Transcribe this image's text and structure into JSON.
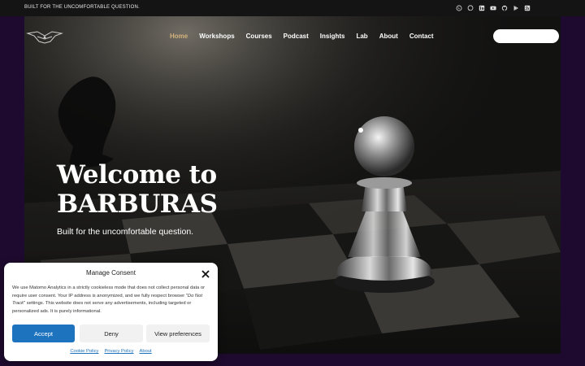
{
  "topbar": {
    "tagline": "BUILT FOR THE UNCOMFORTABLE QUESTION.",
    "socials": [
      "whatsapp-icon",
      "chat-icon",
      "linkedin-icon",
      "youtube-icon",
      "github-icon",
      "play-icon",
      "rss-icon"
    ]
  },
  "nav": {
    "items": [
      "Home",
      "Workshops",
      "Courses",
      "Podcast",
      "Insights",
      "Lab",
      "About",
      "Contact"
    ],
    "active": "Home",
    "cta_label": ""
  },
  "hero": {
    "title_line1": "Welcome to",
    "title_line2": "BARBURAS",
    "subtitle": "Built for the uncomfortable question."
  },
  "consent": {
    "title": "Manage Consent",
    "body_part1": "We use Matomo Analytics in a strictly cookieless mode that does not collect personal data or require user consent. Your IP address is anonymized, and we fully respect browser \"",
    "body_italic": "Do Not Track",
    "body_part2": "\" settings. This website does not serve any advertisements, including targeted or personalized ads. It is purely informational.",
    "accept": "Accept",
    "deny": "Deny",
    "preferences": "View preferences",
    "links": [
      "Cookie Policy",
      "Privacy Policy",
      "About"
    ]
  },
  "colors": {
    "accent_nav": "#d4b27a",
    "accept_button": "#1e73be",
    "page_background": "#1e0a2e",
    "topbar_background": "#141414"
  }
}
